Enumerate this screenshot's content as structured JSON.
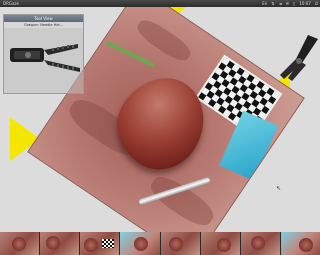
{
  "window": {
    "title": "DRGaze"
  },
  "tray": {
    "items": [
      {
        "icon": "keyboard-icon",
        "label": "En"
      },
      {
        "icon": "network-icon",
        "label": "⇅"
      },
      {
        "icon": "volume-icon",
        "label": "◄"
      },
      {
        "icon": "mail-icon",
        "label": "✉"
      },
      {
        "icon": "battery-icon",
        "label": "▯"
      }
    ],
    "clock": "10:07",
    "power_glyph": "⏻"
  },
  "panel": {
    "header": "Tool View",
    "subtitle": "Grasper: Needle Hdr..."
  },
  "thumbnails": {
    "count": 8
  },
  "colors": {
    "topbar": "#3a3a3a",
    "workspace": "#dcdcdc",
    "yellow_corner": "#f3e600",
    "cloth": "#c08a82"
  }
}
